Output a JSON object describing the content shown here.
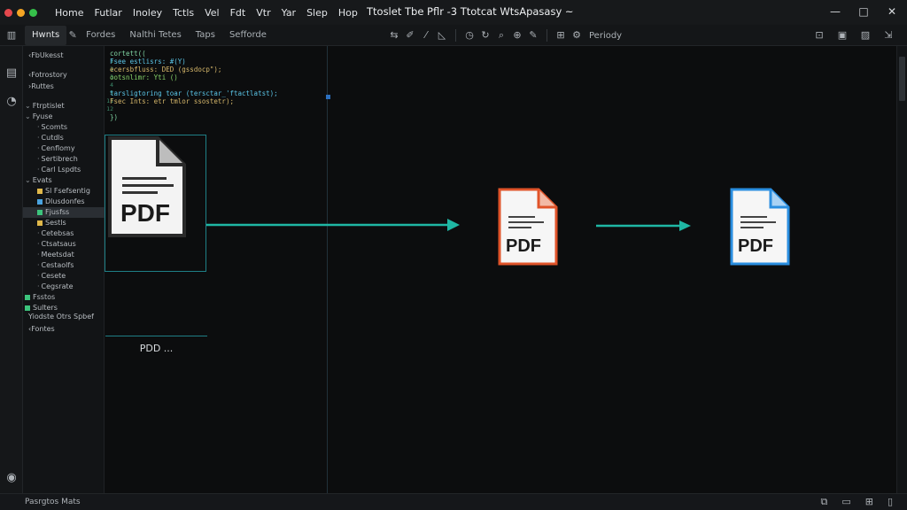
{
  "window": {
    "title": "Ttoslet Tbe Pflr -3 Ttotcat WtsApasasy ~",
    "traffic_colors": [
      "#e5484d",
      "#f5a524",
      "#36c04a"
    ],
    "controls": [
      "—",
      "□",
      "✕"
    ]
  },
  "menu": [
    "Home",
    "Futlar",
    "Inoley",
    "Tctls",
    "Vel",
    "Fdt",
    "Vtr",
    "Yar",
    "Slep",
    "Hop"
  ],
  "toolbar": {
    "tabs": [
      "Hwnts",
      "Fordes",
      "Nalthi Tetes",
      "Taps",
      "Sefforde"
    ],
    "periodly": "Periody",
    "tool_icons": [
      "move-icon",
      "pen-icon",
      "line-icon",
      "shape-icon",
      "clock-icon",
      "refresh-icon",
      "search-icon",
      "zoom-icon",
      "edit-icon",
      "grid-icon",
      "settings-icon"
    ],
    "right_icons": [
      "lock-icon",
      "save-icon",
      "image-icon",
      "export-icon"
    ]
  },
  "sidebar": {
    "header": "FbUkesst",
    "sections": [
      "Fotrostory",
      "Ruttes"
    ],
    "tree": [
      {
        "label": "Ftrptislet",
        "depth": 0,
        "open": true
      },
      {
        "label": "Fyuse",
        "depth": 0,
        "open": true
      },
      {
        "label": "Scomts",
        "depth": 1
      },
      {
        "label": "Cutdls",
        "depth": 1
      },
      {
        "label": "Cenflomy",
        "depth": 1
      },
      {
        "label": "Sertibrech",
        "depth": 1
      },
      {
        "label": "Carl Lspdts",
        "depth": 1
      },
      {
        "label": "Evats",
        "depth": 0,
        "open": true
      },
      {
        "label": "Sl Fsefsentig",
        "depth": 1
      },
      {
        "label": "Dlusdonfes",
        "depth": 1
      },
      {
        "label": "Fjusfss",
        "depth": 1,
        "selected": true
      },
      {
        "label": "Sestls",
        "depth": 1
      },
      {
        "label": "Cetebsas",
        "depth": 1
      },
      {
        "label": "Ctsatsaus",
        "depth": 1
      },
      {
        "label": "Meetsdat",
        "depth": 1
      },
      {
        "label": "Cestaolfs",
        "depth": 1
      },
      {
        "label": "Cesete",
        "depth": 1
      },
      {
        "label": "Cegsrate",
        "depth": 1
      },
      {
        "label": "Fsstos",
        "depth": 0
      },
      {
        "label": "Sulters",
        "depth": 0
      }
    ],
    "footer": [
      "Yiodste Otrs Spbef",
      "Fontes"
    ]
  },
  "editor": {
    "code": [
      {
        "n": "",
        "text": "cortett(("
      },
      {
        "n": "1",
        "text": "  Fsee estlisrs: #(Y)"
      },
      {
        "n": "2",
        "text": "    ecersbfluss: DED (gssdocp\");"
      },
      {
        "n": "3",
        "text": "    ootsnlimr: Yti ()"
      },
      {
        "n": "4",
        "text": ""
      },
      {
        "n": "5",
        "text": "    tarsligtoring toar (tersctar_'ftactlatst);"
      },
      {
        "n": "11",
        "text": "      Fsec Ints: etr tmlor ssostetr);"
      },
      {
        "n": "12",
        "text": ""
      },
      {
        "n": "",
        "text": "  })"
      }
    ],
    "pdf_caption": "PDD ...",
    "pdf_label": "PDF"
  },
  "status": {
    "text": "Pasrgtos Mats",
    "icons": [
      "copy-icon",
      "chat-icon",
      "grid-icon",
      "panel-icon"
    ]
  }
}
